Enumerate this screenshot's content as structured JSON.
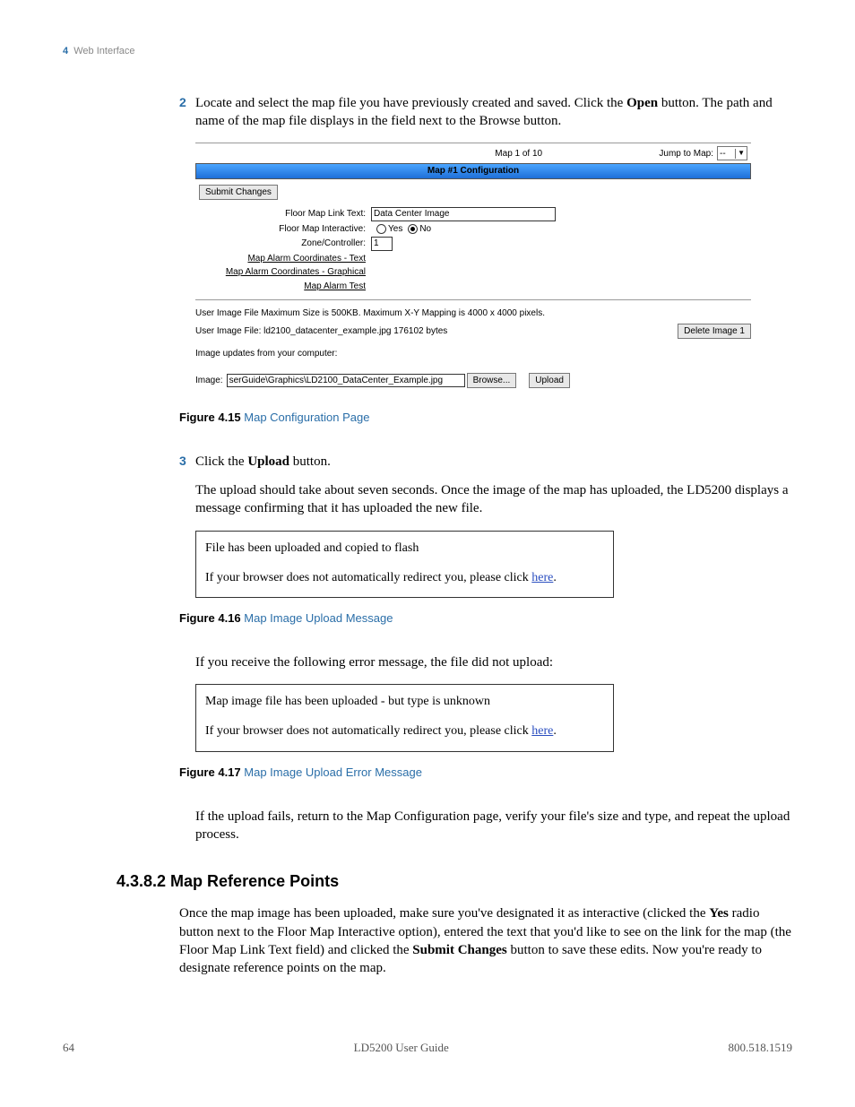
{
  "header": {
    "chapter_num": "4",
    "chapter_title": "Web Interface"
  },
  "steps": {
    "s2": {
      "num": "2",
      "text_before_open": "Locate and select the map file you have previously created and saved. Click the ",
      "open_word": "Open",
      "text_after_open": " button. The path and name of the map file displays in the field next to the Browse button."
    },
    "s3": {
      "num": "3",
      "line1_before": "Click the ",
      "upload_word": "Upload",
      "line1_after": " button.",
      "para2": "The upload should take about seven seconds. Once the image of the map has uploaded, the LD5200 displays a message confirming that it has uploaded the new file."
    }
  },
  "fig15": {
    "num": "Figure 4.15",
    "title": "Map Configuration Page"
  },
  "fig16": {
    "num": "Figure 4.16",
    "title": "Map Image Upload Message"
  },
  "fig17": {
    "num": "Figure 4.17",
    "title": "Map Image Upload Error Message"
  },
  "error_intro": "If you receive the following error message, the file did not upload:",
  "retry_para": "If the upload fails, return to the Map Configuration page, verify your file's size and type, and repeat the upload process.",
  "heading4382": "4.3.8.2 Map Reference Points",
  "refpoints_para": {
    "p1a": "Once the map image has been uploaded, make sure you've designated it as interactive (clicked the ",
    "yes_word": "Yes",
    "p1b": " radio button next to the Floor Map Interactive option), entered the text that you'd like to see on the link for the map (the Floor Map Link Text field) and clicked the ",
    "submit_word": "Submit Changes",
    "p1c": " button to save these edits. Now you're ready to designate reference points on the map."
  },
  "ss1": {
    "map_count": "Map 1 of 10",
    "jump_label": "Jump to Map:",
    "jump_value": "--",
    "band": "Map #1 Configuration",
    "submit_btn": "Submit Changes",
    "link_text_label": "Floor Map Link Text:",
    "link_text_value": "Data Center Image",
    "interactive_label": "Floor Map Interactive:",
    "yes": "Yes",
    "no": "No",
    "zone_label": "Zone/Controller:",
    "zone_value": "1",
    "coord_text": "Map Alarm Coordinates - Text",
    "coord_graph": "Map Alarm Coordinates - Graphical",
    "alarm_test": "Map Alarm Test",
    "maxsize": "User Image File Maximum Size is 500KB. Maximum X-Y Mapping is 4000 x 4000 pixels.",
    "userfile": "User Image File: ld2100_datacenter_example.jpg 176102 bytes",
    "delete_btn": "Delete Image 1",
    "updates_label": "Image updates from your computer:",
    "image_label": "Image:",
    "image_path": "serGuide\\Graphics\\LD2100_DataCenter_Example.jpg",
    "browse_btn": "Browse...",
    "upload_btn": "Upload"
  },
  "msg_ok": {
    "line1": "File has been uploaded and copied to flash",
    "line2a": "If your browser does not automatically redirect you, please click ",
    "here": "here",
    "line2b": "."
  },
  "msg_err": {
    "line1": "Map image file has been uploaded - but type is unknown",
    "line2a": "If your browser does not automatically redirect you, please click ",
    "here": "here",
    "line2b": "."
  },
  "footer": {
    "page": "64",
    "title": "LD5200 User Guide",
    "phone": "800.518.1519"
  }
}
